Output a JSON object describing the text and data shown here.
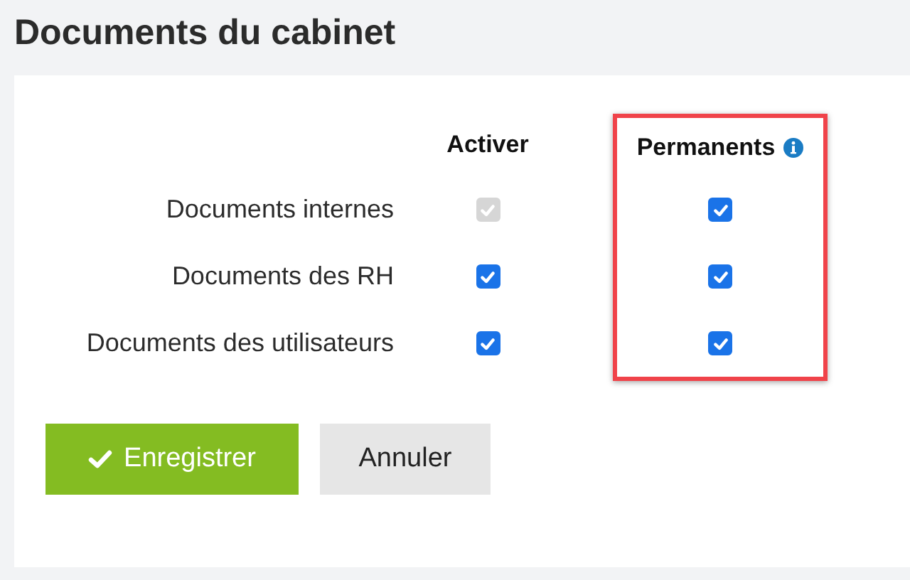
{
  "page": {
    "title": "Documents du cabinet"
  },
  "table": {
    "columns": [
      {
        "label": "Activer",
        "highlighted": false,
        "info": false
      },
      {
        "label": "Permanents",
        "highlighted": true,
        "info": true
      }
    ],
    "rows": [
      {
        "label": "Documents internes",
        "cells": [
          {
            "checked": true,
            "disabled": true
          },
          {
            "checked": true,
            "disabled": false
          }
        ]
      },
      {
        "label": "Documents des RH",
        "cells": [
          {
            "checked": true,
            "disabled": false
          },
          {
            "checked": true,
            "disabled": false
          }
        ]
      },
      {
        "label": "Documents des utilisateurs",
        "cells": [
          {
            "checked": true,
            "disabled": false
          },
          {
            "checked": true,
            "disabled": false
          }
        ]
      }
    ]
  },
  "buttons": [
    {
      "label": "Enregistrer",
      "kind": "primary"
    },
    {
      "label": "Annuler",
      "kind": "secondary"
    }
  ]
}
